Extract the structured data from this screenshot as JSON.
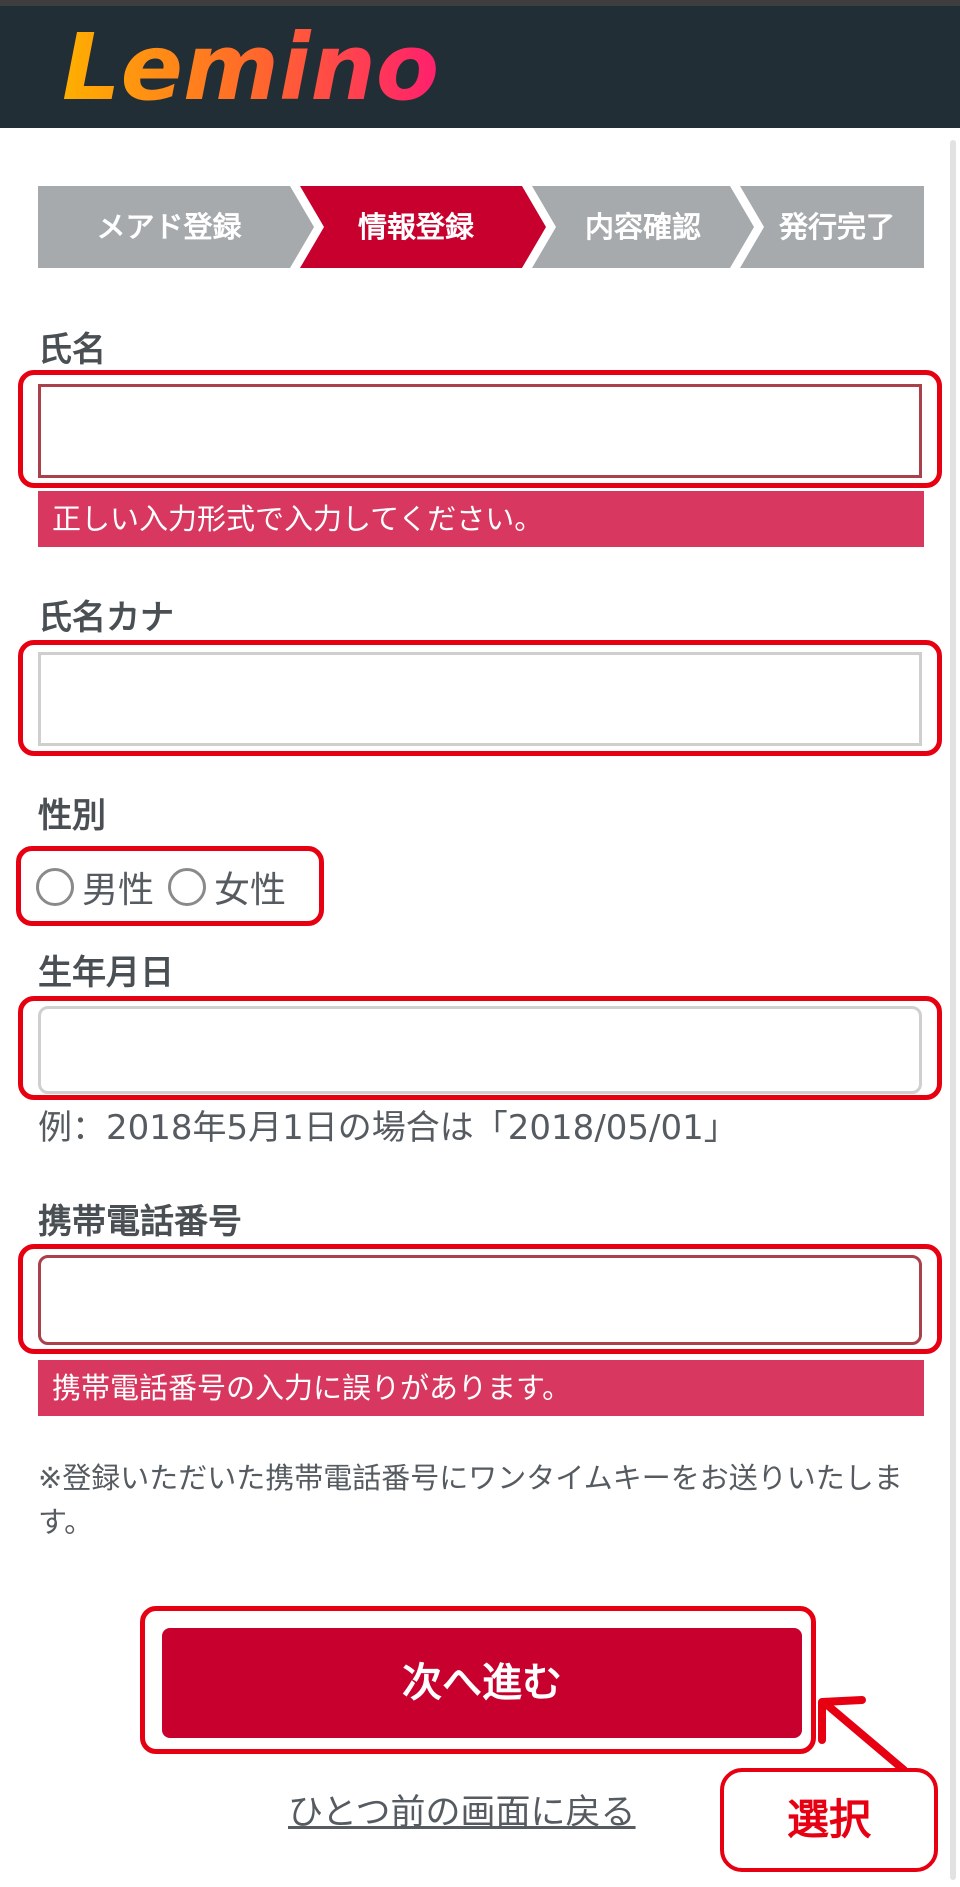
{
  "brand": {
    "logo_text": "Lemino"
  },
  "steps": [
    {
      "label": "メアド登録",
      "active": false
    },
    {
      "label": "情報登録",
      "active": true
    },
    {
      "label": "内容確認",
      "active": false
    },
    {
      "label": "発行完了",
      "active": false
    }
  ],
  "form": {
    "name": {
      "label": "氏名",
      "value": "",
      "error": "正しい入力形式で入力してください。"
    },
    "kana": {
      "label": "氏名カナ",
      "value": ""
    },
    "gender": {
      "label": "性別",
      "options": [
        "男性",
        "女性"
      ]
    },
    "birthday": {
      "label": "生年月日",
      "value": "",
      "hint": "例：2018年5月1日の場合は「2018/05/01」"
    },
    "phone": {
      "label": "携帯電話番号",
      "value": "",
      "error": "携帯電話番号の入力に誤りがあります。"
    },
    "note": "※登録いただいた携帯電話番号にワンタイムキーをお送りいたします。"
  },
  "actions": {
    "next": "次へ進む",
    "back": "ひとつ前の画面に戻る"
  },
  "callout": {
    "label": "選択"
  },
  "colors": {
    "header": "#222e35",
    "accent": "#c8002e",
    "error": "#d8385f",
    "step_inactive": "#a6aaad",
    "annotation": "#e60012"
  }
}
